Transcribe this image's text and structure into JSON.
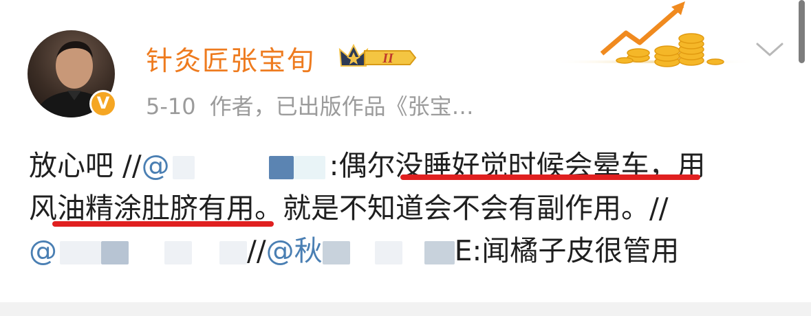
{
  "author": {
    "name": "针灸匠张宝旬",
    "verified_badge": "V",
    "level_badge": "II",
    "avatar_icon": "user-avatar"
  },
  "post_meta": {
    "date": "5-10",
    "source": "作者，已出版作品《张宝…"
  },
  "post": {
    "line1_a": "放心吧 //",
    "line1_mention": "@",
    "line1_b": ":偶尔没睡好觉时候会晕车，用",
    "line2": "风油精涂肚脐有用。就是不知道会不会有副作用。//",
    "line3_mention1": "@",
    "line3_mid": "//",
    "line3_mention2": "@秋",
    "line3_tail": "E:闻橘子皮很管用"
  },
  "colors": {
    "name": "#ee7b1f",
    "mention": "#4a7fb3",
    "meta": "#9b9b9b",
    "underline": "#e02020"
  },
  "icons": {
    "expand": "chevron-down-icon",
    "decoration": "rising-chart-coins-icon"
  }
}
